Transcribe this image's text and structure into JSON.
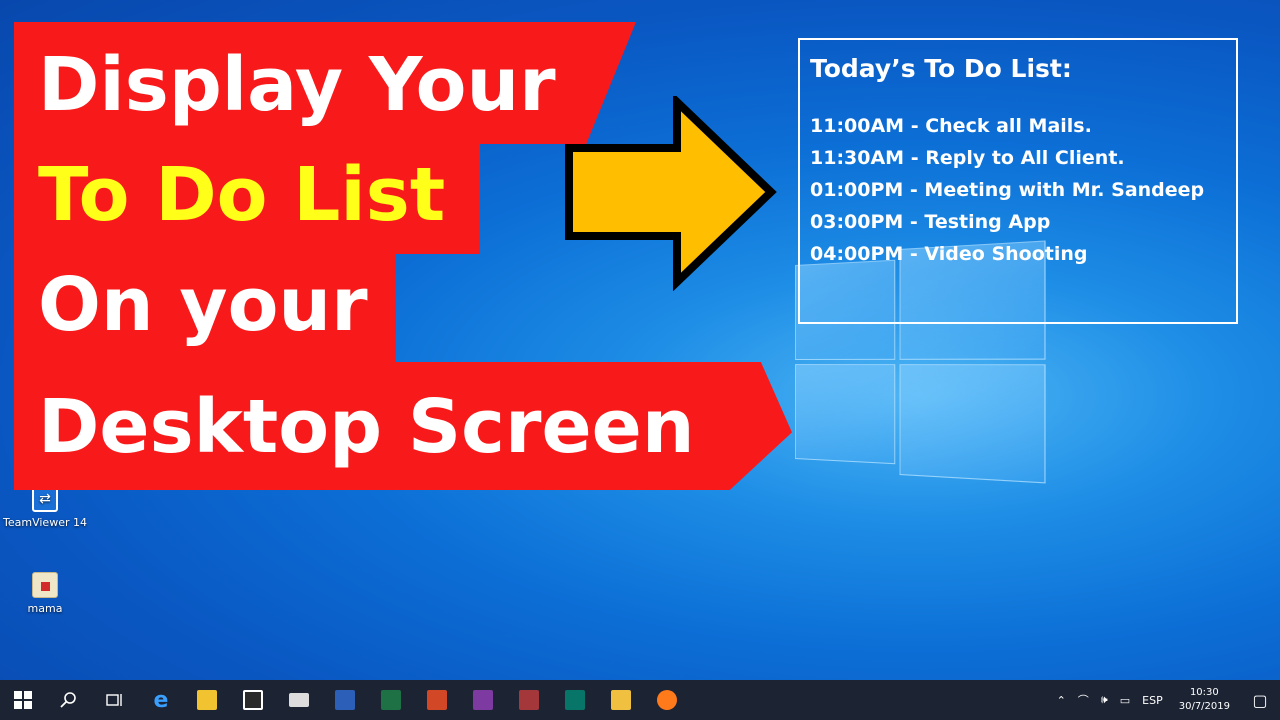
{
  "banners": {
    "line1": "Display Your",
    "line2": "To Do List",
    "line3": "On your",
    "line4": "Desktop Screen"
  },
  "todo": {
    "title": "Today’s To Do List:",
    "items": [
      "11:00AM - Check all Mails.",
      "11:30AM - Reply to All Client.",
      "01:00PM - Meeting with Mr. Sandeep",
      "03:00PM - Testing App",
      "04:00PM - Video Shooting"
    ]
  },
  "desktop_icons": {
    "teamviewer": "TeamViewer 14",
    "mama": "mama"
  },
  "taskbar": {
    "apps": [
      "start-icon",
      "search-icon",
      "task-view-icon",
      "edge-icon",
      "file-explorer-icon",
      "store-icon",
      "mail-icon",
      "word-icon",
      "excel-icon",
      "powerpoint-icon",
      "onenote-icon",
      "access-icon",
      "publisher-icon",
      "outlook-icon",
      "firefox-icon"
    ],
    "tray": {
      "language": "ESP",
      "time": "10:30",
      "date": "30/7/2019"
    }
  },
  "colors": {
    "banner_red": "#f81a1a",
    "highlight_yellow": "#ffff1a",
    "arrow_fill": "#ffbe00",
    "taskbar": "#1c2332"
  }
}
